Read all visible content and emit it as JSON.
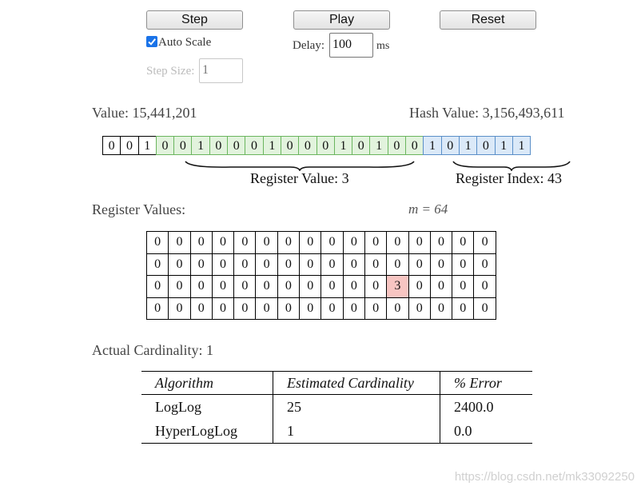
{
  "controls": {
    "step_label": "Step",
    "play_label": "Play",
    "reset_label": "Reset",
    "auto_scale_label": "Auto Scale",
    "auto_scale_checked": true,
    "delay_label": "Delay:",
    "delay_value": "100",
    "delay_unit": "ms",
    "step_size_label": "Step Size:",
    "step_size_value": "1"
  },
  "hash": {
    "value_text": "Value: 15,441,201",
    "hash_value_text": "Hash Value: 3,156,493,611",
    "bits": [
      {
        "v": "0",
        "c": "none"
      },
      {
        "v": "0",
        "c": "none"
      },
      {
        "v": "1",
        "c": "none"
      },
      {
        "v": "0",
        "c": "green"
      },
      {
        "v": "0",
        "c": "green"
      },
      {
        "v": "1",
        "c": "green"
      },
      {
        "v": "0",
        "c": "green"
      },
      {
        "v": "0",
        "c": "green"
      },
      {
        "v": "0",
        "c": "green"
      },
      {
        "v": "1",
        "c": "green"
      },
      {
        "v": "0",
        "c": "green"
      },
      {
        "v": "0",
        "c": "green"
      },
      {
        "v": "0",
        "c": "green"
      },
      {
        "v": "1",
        "c": "green"
      },
      {
        "v": "0",
        "c": "green"
      },
      {
        "v": "1",
        "c": "green"
      },
      {
        "v": "0",
        "c": "green"
      },
      {
        "v": "0",
        "c": "green"
      },
      {
        "v": "1",
        "c": "blue"
      },
      {
        "v": "0",
        "c": "blue"
      },
      {
        "v": "1",
        "c": "blue"
      },
      {
        "v": "0",
        "c": "blue"
      },
      {
        "v": "1",
        "c": "blue"
      },
      {
        "v": "1",
        "c": "blue"
      }
    ],
    "register_value_label": "Register Value: 3",
    "register_index_label": "Register Index: 43"
  },
  "registers": {
    "label": "Register Values:",
    "m_label": "m = 64",
    "rows": [
      [
        "0",
        "0",
        "0",
        "0",
        "0",
        "0",
        "0",
        "0",
        "0",
        "0",
        "0",
        "0",
        "0",
        "0",
        "0",
        "0"
      ],
      [
        "0",
        "0",
        "0",
        "0",
        "0",
        "0",
        "0",
        "0",
        "0",
        "0",
        "0",
        "0",
        "0",
        "0",
        "0",
        "0"
      ],
      [
        "0",
        "0",
        "0",
        "0",
        "0",
        "0",
        "0",
        "0",
        "0",
        "0",
        "0",
        "3",
        "0",
        "0",
        "0",
        "0"
      ],
      [
        "0",
        "0",
        "0",
        "0",
        "0",
        "0",
        "0",
        "0",
        "0",
        "0",
        "0",
        "0",
        "0",
        "0",
        "0",
        "0"
      ]
    ],
    "highlight": {
      "row": 2,
      "col": 11
    }
  },
  "results": {
    "actual_cardinality_text": "Actual Cardinality: 1",
    "headers": [
      "Algorithm",
      "Estimated Cardinality",
      "% Error"
    ],
    "rows": [
      [
        "LogLog",
        "25",
        "2400.0"
      ],
      [
        "HyperLogLog",
        "1",
        "0.0"
      ]
    ]
  },
  "colors": {
    "accent": "#1a73e8",
    "register_value_bits": "#e2f3dd",
    "register_index_bits": "#dbe9f8",
    "highlight_cell": "#f7c5c2"
  },
  "watermark": "https://blog.csdn.net/mk33092250"
}
